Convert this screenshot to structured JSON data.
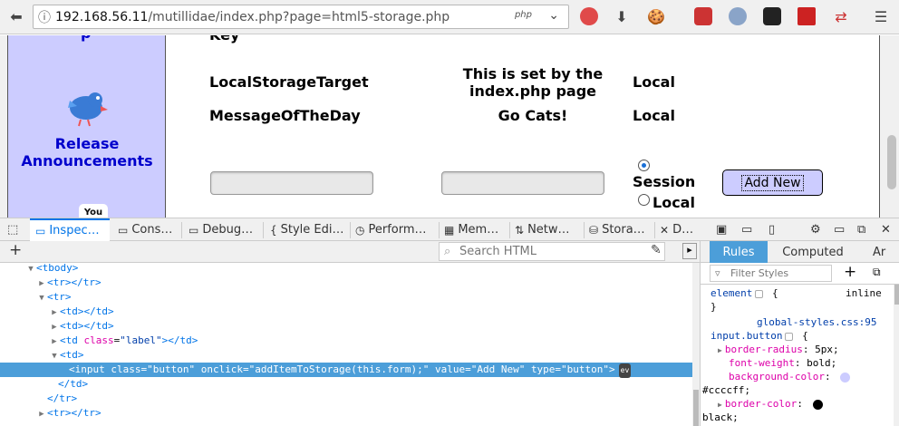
{
  "browser": {
    "url_host": "192.168.56.11",
    "url_path": "/mutillidae/index.php?page=html5-storage.php",
    "url_badge": "php"
  },
  "page": {
    "sidebar_partial_title": "p",
    "release_line1": "Release",
    "release_line2": "Announcements",
    "youtube_label": "You",
    "header_partial": "Key",
    "rows": [
      {
        "key": "LocalStorageTarget",
        "value_line1": "This is set by the",
        "value_line2": "index.php page",
        "type": "Local"
      },
      {
        "key": "MessageOfTheDay",
        "value_line1": "Go Cats!",
        "value_line2": "",
        "type": "Local"
      }
    ],
    "radio_session": "Session",
    "radio_local": "Local",
    "add_button": "Add New"
  },
  "devtools": {
    "tabs": [
      {
        "label": "Inspector",
        "icon": "inspector-icon"
      },
      {
        "label": "Console",
        "icon": "console-icon"
      },
      {
        "label": "Debugger",
        "icon": "debugger-icon"
      },
      {
        "label": "Style Editor",
        "icon": "style-editor-icon"
      },
      {
        "label": "Performance",
        "icon": "performance-icon"
      },
      {
        "label": "Memory",
        "icon": "memory-icon"
      },
      {
        "label": "Network",
        "icon": "network-icon"
      },
      {
        "label": "Storage",
        "icon": "storage-icon"
      },
      {
        "label": "DOM",
        "icon": "dom-icon"
      }
    ],
    "tab_display": [
      "Inspec…",
      "Cons…",
      "Debug…",
      "Style Edi…",
      "Perform…",
      "Mem…",
      "Netw…",
      "Stora…",
      "D…"
    ],
    "search_placeholder": "Search HTML",
    "markup": {
      "tbody_open": "<tbody>",
      "tr_collapsed": "<tr></tr>",
      "tr_open": "<tr>",
      "td_collapsed": "<td></td>",
      "td_label_open": "<td ",
      "td_label_attr": "class",
      "td_label_val": "\"label\"",
      "td_label_close": "></td>",
      "td_open": "<td>",
      "input_open": "<input ",
      "input_attrs": "class=\"button\" onclick=\"addItemToStorage(this.form);\" value=\"Add New\" type=\"button\">",
      "ev_badge": "ev",
      "td_close": "</td>",
      "tr_close": "</tr>",
      "tr_last": "<tr></tr>"
    },
    "sidebar_tabs": [
      "Rules",
      "Computed",
      "Ar"
    ],
    "filter_placeholder": "Filter Styles",
    "rules": {
      "element_selector": "element",
      "inline_label": "inline",
      "source_file": "global-styles.css:95",
      "input_selector": "input.button",
      "prop1": "border-radius",
      "val1": "5px",
      "prop2": "font-weight",
      "val2": "bold",
      "prop3": "background-color",
      "val3": "#ccccff",
      "prop4": "border-color",
      "val4": "black"
    }
  },
  "colors": {
    "sidebar_bg": "#ccccff",
    "accent": "#0074e8",
    "selection": "#4c9ed9",
    "link_blue": "#0000cc"
  }
}
